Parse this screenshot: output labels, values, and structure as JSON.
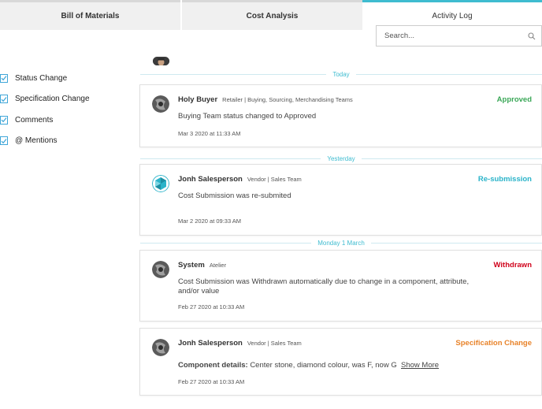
{
  "tabs": [
    {
      "label": "Bill of Materials"
    },
    {
      "label": "Cost Analysis"
    },
    {
      "label": "Activity Log"
    }
  ],
  "search": {
    "placeholder": "Search..."
  },
  "filters": [
    {
      "label": "Status Change",
      "checked": true
    },
    {
      "label": "Specification Change",
      "checked": true
    },
    {
      "label": "Comments",
      "checked": true
    },
    {
      "label": "@ Mentions",
      "checked": true
    }
  ],
  "separators": [
    "Today",
    "Yesterday",
    "Monday 1 March"
  ],
  "entries": [
    {
      "name": "Holy Buyer",
      "role": "Retailer | Buying, Sourcing, Merchandising Teams",
      "status": "Approved",
      "status_color": "#3aa757",
      "message": "Buying Team status changed to Approved",
      "time": "Mar 3 2020 at 11:33 AM"
    },
    {
      "name": "Jonh Salesperson",
      "role": "Vendor | Sales Team",
      "status": "Re-submission",
      "status_color": "#2ab3c9",
      "message": "Cost Submission was re-submited",
      "time": "Mar 2 2020 at 09:33 AM"
    },
    {
      "name": "System",
      "role": "Atelier",
      "status": "Withdrawn",
      "status_color": "#d0021b",
      "message": "Cost Submission was Withdrawn automatically due to change in a component, attribute, and/or value",
      "time": "Feb 27 2020 at 10:33 AM"
    },
    {
      "name": "Jonh Salesperson",
      "role": "Vendor | Sales Team",
      "status": "Specification Change",
      "status_color": "#e8832a",
      "message_label": "Component details:",
      "message": "Center stone, diamond colour, was F, now G",
      "show_more": "Show More",
      "time": "Feb 27 2020 at 10:33 AM"
    }
  ],
  "colors": {
    "accent": "#3fbcd0",
    "checkbox": "#3fa6d8"
  },
  "icons": {
    "search": "search-icon",
    "check": "check-icon"
  }
}
